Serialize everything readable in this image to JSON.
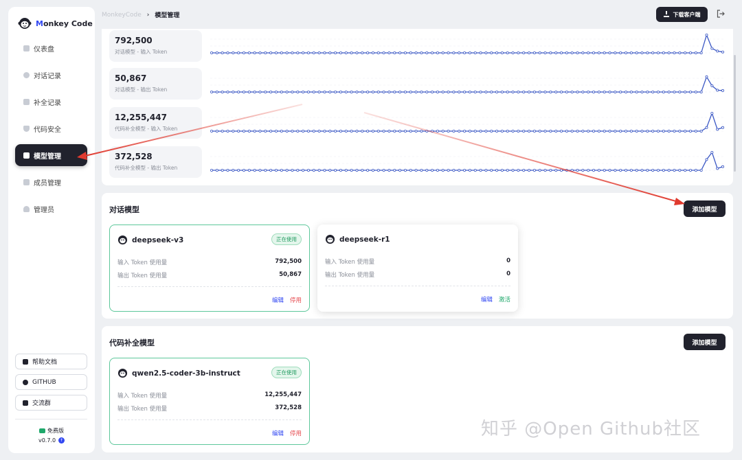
{
  "app": {
    "name_prefix": "M",
    "name_rest": "onkey Code"
  },
  "sidebar": {
    "items": [
      {
        "label": "仪表盘",
        "icon": "dashboard-icon"
      },
      {
        "label": "对话记录",
        "icon": "chat-icon"
      },
      {
        "label": "补全记录",
        "icon": "clipboard-icon"
      },
      {
        "label": "代码安全",
        "icon": "shield-icon"
      },
      {
        "label": "模型管理",
        "icon": "cube-icon",
        "active": true
      },
      {
        "label": "成员管理",
        "icon": "users-icon"
      },
      {
        "label": "管理员",
        "icon": "user-icon"
      }
    ],
    "links": [
      {
        "label": "帮助文档",
        "icon": "doc-icon"
      },
      {
        "label": "GITHUB",
        "icon": "github-icon"
      },
      {
        "label": "交流群",
        "icon": "group-icon"
      }
    ],
    "plan": "免费版",
    "version": "v0.7.0"
  },
  "header": {
    "breadcrumb_home": "MonkeyCode",
    "breadcrumb_sep": "›",
    "breadcrumb_current": "模型管理",
    "download_label": "下载客户端",
    "logout_icon": "logout-icon"
  },
  "stats": [
    {
      "value": "792,500",
      "label": "对话模型 - 输入 Token"
    },
    {
      "value": "50,867",
      "label": "对话模型 - 输出 Token"
    },
    {
      "value": "12,255,447",
      "label": "代码补全模型 - 输入 Token"
    },
    {
      "value": "372,528",
      "label": "代码补全模型 - 输出 Token"
    }
  ],
  "sparklines": [
    {
      "spike": [
        0,
        0,
        0,
        0,
        0,
        0,
        0,
        0,
        0,
        0,
        0,
        0,
        1.0,
        0.25,
        0.1,
        0.05
      ]
    },
    {
      "spike": [
        0,
        0,
        0,
        0,
        0,
        0,
        0,
        0,
        0,
        0,
        0,
        0,
        0.85,
        0.35,
        0.1,
        0.08
      ]
    },
    {
      "spike": [
        0,
        0,
        0,
        0,
        0,
        0,
        0,
        0,
        0,
        0,
        0,
        0,
        0.2,
        1.0,
        0.1,
        0.2
      ]
    },
    {
      "spike": [
        0,
        0,
        0,
        0,
        0,
        0,
        0,
        0,
        0,
        0,
        0,
        0,
        0.6,
        1.0,
        0.1,
        0.2
      ]
    }
  ],
  "chat_section": {
    "title": "对话模型",
    "add_label": "添加模型",
    "models": [
      {
        "name": "deepseek-v3",
        "badge": "正在使用",
        "in_label": "输入 Token 使用量",
        "in_value": "792,500",
        "out_label": "输出 Token 使用量",
        "out_value": "50,867",
        "edit": "编辑",
        "action": "停用",
        "active": true
      },
      {
        "name": "deepseek-r1",
        "badge": "",
        "in_label": "输入 Token 使用量",
        "in_value": "0",
        "out_label": "输出 Token 使用量",
        "out_value": "0",
        "edit": "编辑",
        "action": "激活",
        "active": false
      }
    ]
  },
  "code_section": {
    "title": "代码补全模型",
    "add_label": "添加模型",
    "models": [
      {
        "name": "qwen2.5-coder-3b-instruct",
        "badge": "正在使用",
        "in_label": "输入 Token 使用量",
        "in_value": "12,255,447",
        "out_label": "输出 Token 使用量",
        "out_value": "372,528",
        "edit": "编辑",
        "action": "停用",
        "active": true
      }
    ]
  },
  "watermark": "知乎 @Open Github社区",
  "colors": {
    "accent": "#3248f2",
    "dark": "#21222d",
    "success": "#1fa86b",
    "danger": "#e5484d",
    "arrow": "#e03a2f"
  }
}
